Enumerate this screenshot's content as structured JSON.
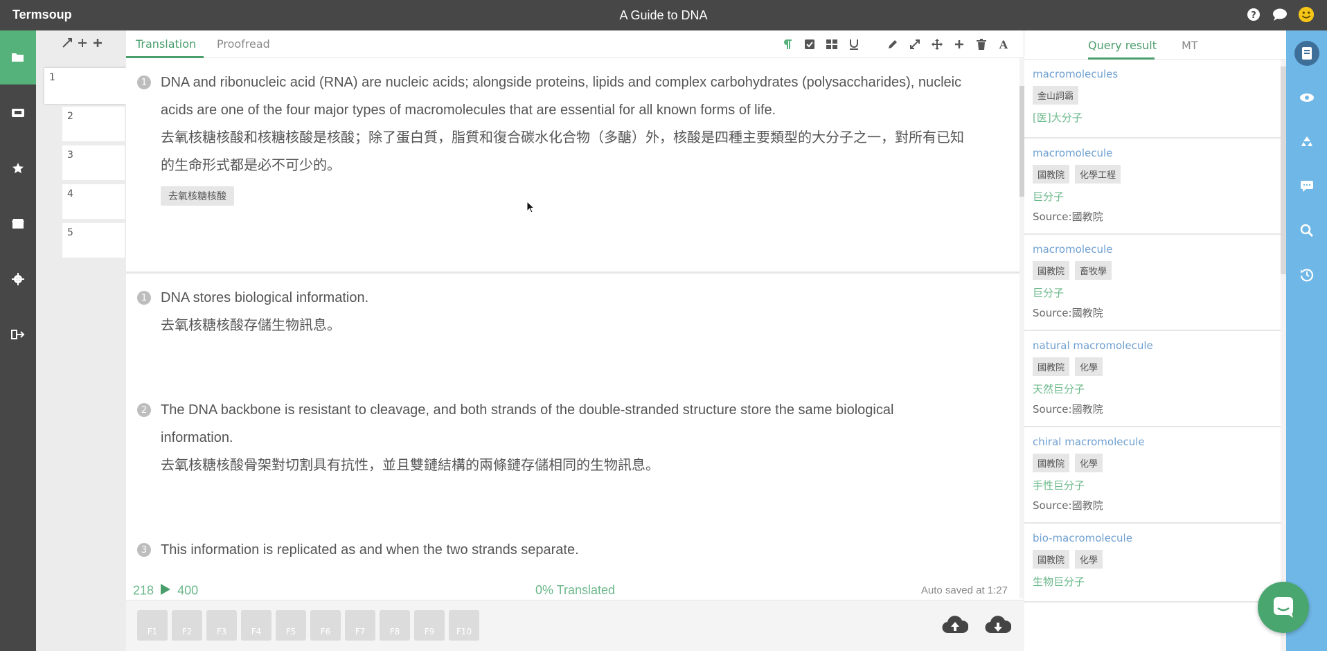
{
  "app": {
    "brand": "Termsoup",
    "document_title": "A Guide to DNA"
  },
  "top_icons": [
    "help-icon",
    "chat-icon",
    "smiley-icon"
  ],
  "left_nav": [
    "folder-icon",
    "archive-icon",
    "star-icon",
    "store-icon",
    "gear-icon",
    "logout-icon"
  ],
  "thumbnails": {
    "pages": [
      "1",
      "2",
      "3",
      "4",
      "5"
    ],
    "active": "1"
  },
  "tabs": {
    "translation": "Translation",
    "proofread": "Proofread"
  },
  "toolbar_icons": [
    "pilcrow-icon",
    "checkbox-icon",
    "grid-icon",
    "underline-icon",
    "pencil-icon",
    "compress-icon",
    "move-icon",
    "plus-icon",
    "trash-icon",
    "font-icon"
  ],
  "segment_top": {
    "num": "1",
    "source": "DNA and ribonucleic acid (RNA) are nucleic acids; alongside proteins, lipids and complex carbohydrates (polysaccharides), nucleic acids are one of the four major types of macromolecules that are essential for all known forms of life.",
    "target": "去氧核糖核酸和核糖核酸是核酸；除了蛋白質，脂質和復合碳水化合物（多醣）外，核酸是四種主要類型的大分子之一，對所有已知的生命形式都是必不可少的。",
    "tag": "去氧核糖核酸"
  },
  "segments": [
    {
      "num": "1",
      "source": "DNA stores biological information.",
      "target": "去氧核糖核酸存儲生物訊息。"
    },
    {
      "num": "2",
      "source": "The DNA backbone is resistant to cleavage, and both strands of the double-stranded structure store the same biological information.",
      "target": "去氧核糖核酸骨架對切割具有抗性，並且雙鏈結構的兩條鏈存儲相同的生物訊息。"
    },
    {
      "num": "3",
      "source": "This information is replicated as and when the two strands separate.",
      "target": ""
    }
  ],
  "status": {
    "words_done": "218",
    "words_total": "400",
    "translated": "0% Translated",
    "saved": "Auto saved at 1:27"
  },
  "fkeys": [
    "F1",
    "F2",
    "F3",
    "F4",
    "F5",
    "F6",
    "F7",
    "F8",
    "F9",
    "F10"
  ],
  "right_tabs": {
    "query": "Query result",
    "mt": "MT"
  },
  "results": [
    {
      "term": "macromolecules",
      "chips": [
        "金山詞霸"
      ],
      "translation": "[医]大分子",
      "source": ""
    },
    {
      "term": "macromolecule",
      "chips": [
        "國教院",
        "化學工程"
      ],
      "translation": "巨分子",
      "source": "Source:國教院"
    },
    {
      "term": "macromolecule",
      "chips": [
        "國教院",
        "畜牧學"
      ],
      "translation": "巨分子",
      "source": "Source:國教院"
    },
    {
      "term": "natural macromolecule",
      "chips": [
        "國教院",
        "化學"
      ],
      "translation": "天然巨分子",
      "source": "Source:國教院"
    },
    {
      "term": "chiral macromolecule",
      "chips": [
        "國教院",
        "化學"
      ],
      "translation": "手性巨分子",
      "source": "Source:國教院"
    },
    {
      "term": "bio-macromolecule",
      "chips": [
        "國教院",
        "化學"
      ],
      "translation": "生物巨分子",
      "source": ""
    }
  ],
  "right_nav": [
    "book-icon",
    "eye-icon",
    "recycle-icon",
    "comment-icon",
    "search-icon",
    "history-icon"
  ],
  "colors": {
    "accent": "#4a9e6c",
    "topbar": "#474747",
    "right_nav": "#6fb7e6",
    "term_link": "#6e9fd0"
  }
}
